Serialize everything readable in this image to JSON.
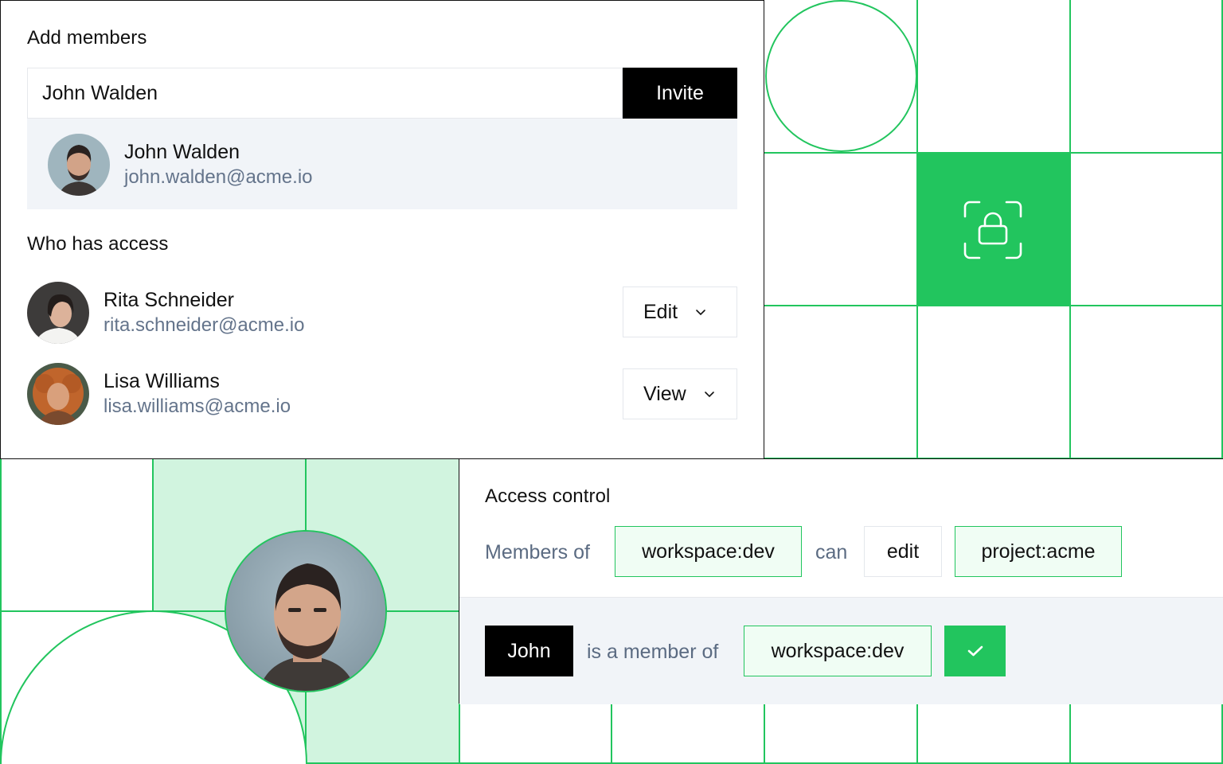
{
  "add_members": {
    "title": "Add members",
    "input_value": "John Walden",
    "invite_label": "Invite",
    "suggestion": {
      "name": "John Walden",
      "email": "john.walden@acme.io"
    }
  },
  "who_has_access": {
    "title": "Who has access",
    "members": [
      {
        "name": "Rita Schneider",
        "email": "rita.schneider@acme.io",
        "role": "Edit"
      },
      {
        "name": "Lisa Williams",
        "email": "lisa.williams@acme.io",
        "role": "View"
      }
    ]
  },
  "access_control": {
    "title": "Access control",
    "rule": {
      "prefix": "Members of",
      "subject": "workspace:dev",
      "verb": "can",
      "permission": "edit",
      "object": "project:acme"
    },
    "check": {
      "user": "John",
      "relation": "is a member of",
      "target": "workspace:dev"
    }
  },
  "colors": {
    "accent_green": "#22c55e",
    "light_green": "#d1f4df",
    "muted_text": "#64748b",
    "suggestion_bg": "#f1f4f8"
  },
  "icons": {
    "lock": "lock-scan-icon",
    "check": "check-icon",
    "chevron": "chevron-down-icon"
  }
}
